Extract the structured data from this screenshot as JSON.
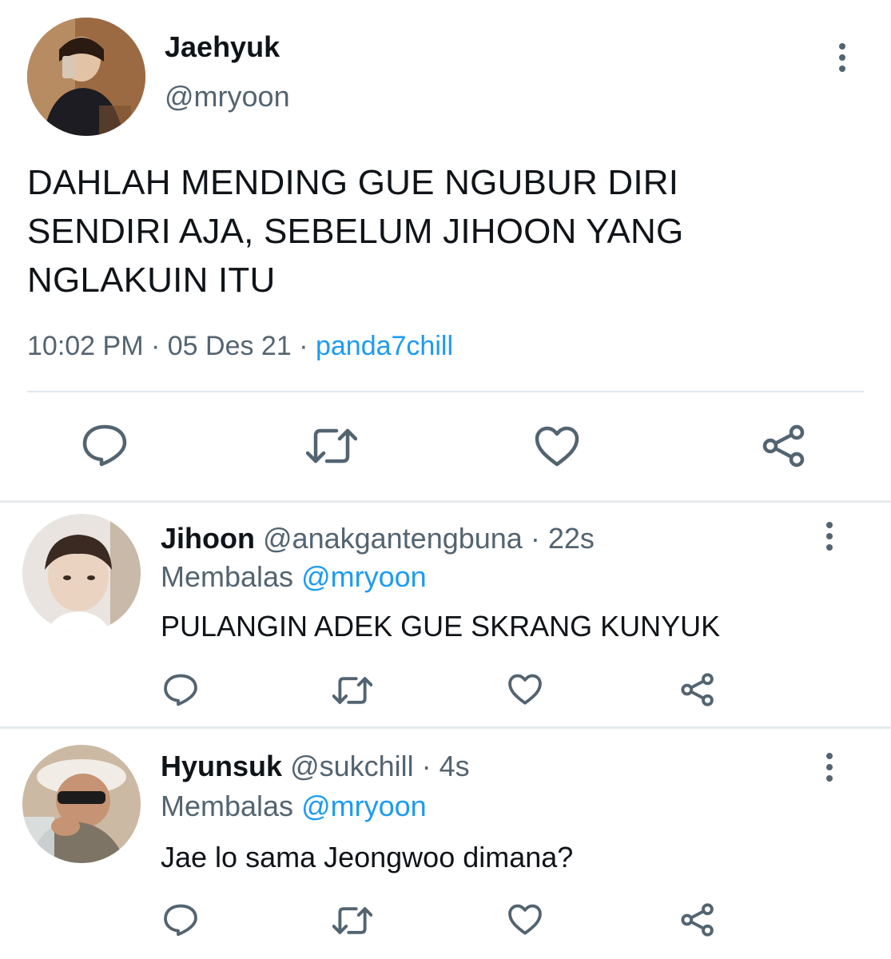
{
  "main_tweet": {
    "display_name": "Jaehyuk",
    "handle": "@mryoon",
    "text_lines": [
      "DAHLAH MENDING GUE NGUBUR DIRI",
      "SENDIRI AJA, SEBELUM JIHOON YANG",
      "NGLAKUIN ITU"
    ],
    "time": "10:02 PM",
    "separator": " · ",
    "date": "05 Des 21",
    "source": "panda7chill",
    "actions": [
      "reply-icon",
      "retweet-icon",
      "like-icon",
      "share-icon"
    ]
  },
  "replies": [
    {
      "display_name": "Jihoon",
      "handle": "@anakgantengbuna",
      "time": "22s",
      "replying_label": "Membalas",
      "replying_to": "@mryoon",
      "text": "PULANGIN ADEK GUE SKRANG KUNYUK"
    },
    {
      "display_name": "Hyunsuk",
      "handle": "@sukchill",
      "time": "4s",
      "replying_label": "Membalas",
      "replying_to": "@mryoon",
      "text": "Jae lo sama Jeongwoo dimana?"
    }
  ],
  "colors": {
    "text": "#0f1419",
    "secondary": "#536471",
    "link": "#1d9bf0",
    "icon": "#536471",
    "divider": "#e1e8ed"
  }
}
